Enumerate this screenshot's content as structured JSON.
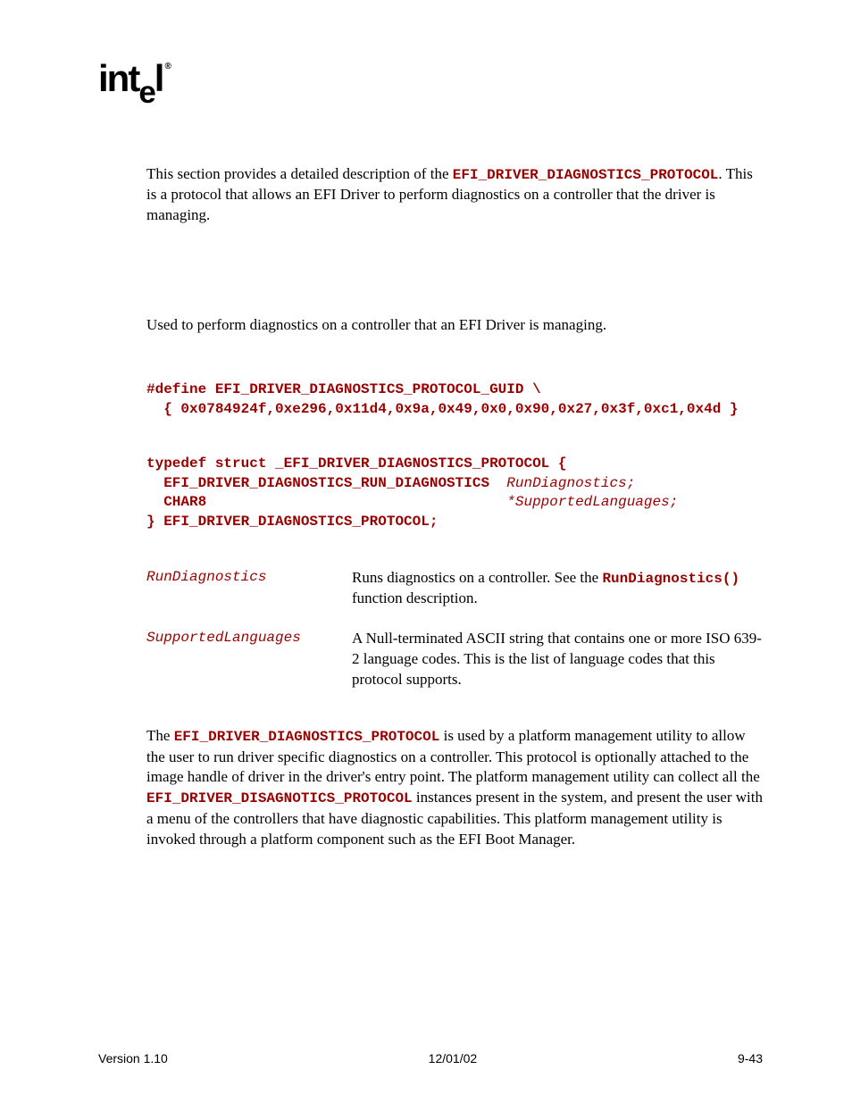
{
  "logo": "intel",
  "intro_pre": "This section provides a detailed description of the ",
  "intro_code": "EFI_DRIVER_DIAGNOSTICS_PROTOCOL",
  "intro_post": ". This is a protocol that allows an EFI Driver to perform diagnostics on a controller that the driver is managing.",
  "summary": "Used to perform diagnostics on a controller that an EFI Driver is managing.",
  "code1_l1": "#define EFI_DRIVER_DIAGNOSTICS_PROTOCOL_GUID \\",
  "code1_l2": "  { 0x0784924f,0xe296,0x11d4,0x9a,0x49,0x0,0x90,0x27,0x3f,0xc1,0x4d }",
  "code2_l1": "typedef struct _EFI_DRIVER_DIAGNOSTICS_PROTOCOL {",
  "code2_l2a": "  EFI_DRIVER_DIAGNOSTICS_RUN_DIAGNOSTICS  ",
  "code2_l2b": "RunDiagnostics;",
  "code2_l3a": "  CHAR8                                   ",
  "code2_l3b": "*SupportedLanguages;",
  "code2_l4": "} EFI_DRIVER_DIAGNOSTICS_PROTOCOL;",
  "params": [
    {
      "name": "RunDiagnostics",
      "desc_pre": "Runs diagnostics on a controller.  See the ",
      "desc_code": "RunDiagnostics()",
      "desc_post": " function description."
    },
    {
      "name": "SupportedLanguages",
      "desc_pre": "A Null-terminated ASCII string that contains one or more ISO 639-2 language codes.  This is the list of language codes that this protocol supports.",
      "desc_code": "",
      "desc_post": ""
    }
  ],
  "desc_p1_pre": "The ",
  "desc_p1_code": "EFI_DRIVER_DIAGNOSTICS_PROTOCOL",
  "desc_p1_mid": " is used by a platform management utility to allow the user to run driver specific diagnostics on a controller.  This protocol is optionally attached to the image handle of driver in the driver's entry point.  The platform management utility can collect all the ",
  "desc_p1_code2": "EFI_DRIVER_DISAGNOTICS_PROTOCOL",
  "desc_p1_post": " instances present in the system, and present the user with a menu of the controllers that have diagnostic capabilities.  This platform management utility is invoked through a platform component such as the EFI Boot Manager.",
  "footer": {
    "left": "Version 1.10",
    "center": "12/01/02",
    "right": "9-43"
  }
}
